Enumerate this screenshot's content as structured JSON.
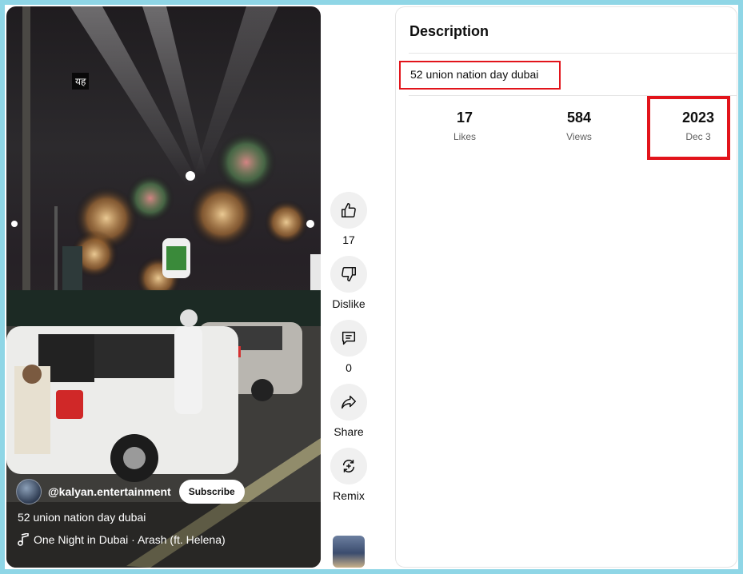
{
  "video": {
    "overlay_tag": "यह",
    "channel": "@kalyan.entertainment",
    "subscribe_label": "Subscribe",
    "title": "52 union nation day dubai",
    "music": "One Night in Dubai · Arash (ft. Helena)"
  },
  "actions": {
    "like_count": "17",
    "dislike_label": "Dislike",
    "comment_count": "0",
    "share_label": "Share",
    "remix_label": "Remix"
  },
  "description_panel": {
    "title": "Description",
    "text": "52 union nation day dubai",
    "stats": [
      {
        "value": "17",
        "label": "Likes"
      },
      {
        "value": "584",
        "label": "Views"
      },
      {
        "value": "2023",
        "label": "Dec 3"
      }
    ]
  },
  "colors": {
    "highlight": "#e2141b",
    "background_border": "#8fd6e6"
  }
}
